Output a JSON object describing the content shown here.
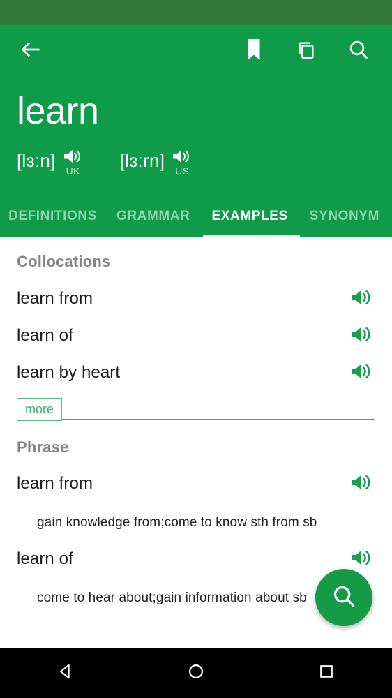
{
  "status_bar": {
    "background": "#33793a"
  },
  "app_bar": {
    "background": "#0f9b4a",
    "back_icon": "arrow-left-icon",
    "actions": [
      {
        "name": "bookmark-icon",
        "label": "Bookmark"
      },
      {
        "name": "copy-icon",
        "label": "Copy"
      },
      {
        "name": "search-icon",
        "label": "Search"
      }
    ]
  },
  "headword": {
    "word": "learn"
  },
  "pronunciations": [
    {
      "ipa": "[lɜːn]",
      "locale": "UK",
      "speaker_icon": "speaker-icon"
    },
    {
      "ipa": "[lɜːrn]",
      "locale": "US",
      "speaker_icon": "speaker-icon"
    }
  ],
  "tabs": {
    "items": [
      {
        "label": "DEFINITIONS",
        "active": false
      },
      {
        "label": "GRAMMAR",
        "active": false
      },
      {
        "label": "EXAMPLES",
        "active": true
      },
      {
        "label": "SYNONYM",
        "active": false
      }
    ],
    "active_index": 2,
    "active_color": "#ffffff",
    "inactive_color": "#95d3ac"
  },
  "content": {
    "collocations": {
      "heading": "Collocations",
      "items": [
        {
          "text": "learn from",
          "speaker_icon": "speaker-icon"
        },
        {
          "text": "learn of",
          "speaker_icon": "speaker-icon"
        },
        {
          "text": "learn by heart",
          "speaker_icon": "speaker-icon"
        }
      ],
      "more_label": "more"
    },
    "phrase": {
      "heading": "Phrase",
      "items": [
        {
          "text": "learn from",
          "speaker_icon": "speaker-icon",
          "definition": "gain knowledge from;come to know sth from sb"
        },
        {
          "text": "learn of",
          "speaker_icon": "speaker-icon",
          "definition": "come to hear about;gain information about sb"
        }
      ]
    }
  },
  "fab": {
    "icon": "search-icon",
    "color": "#159b46"
  },
  "nav_bar": {
    "buttons": [
      {
        "name": "nav-back-icon",
        "label": "Back"
      },
      {
        "name": "nav-home-icon",
        "label": "Home"
      },
      {
        "name": "nav-recents-icon",
        "label": "Recents"
      }
    ]
  },
  "colors": {
    "brand_green": "#0f9b4a",
    "status_green": "#33793a",
    "speaker_green": "#17a04f",
    "heading_gray": "#858585"
  }
}
